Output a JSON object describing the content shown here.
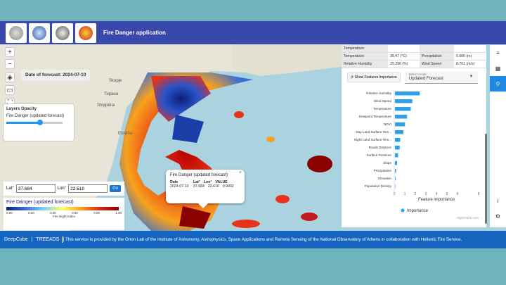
{
  "header": {
    "title": "Fire Danger application",
    "logos": [
      "gov-seal-logo",
      "iaasars-logo",
      "orion-lab-logo",
      "fire-service-logo"
    ],
    "logo_colors": [
      "#8a8a8a",
      "#2d5ea8",
      "#555",
      "#c62828"
    ]
  },
  "map": {
    "forecast_label": "Date of forecast: 2024-07-10",
    "zoom_in": "+",
    "zoom_out": "−",
    "layers_opacity": {
      "title": "Layers Opacity",
      "layer_name": "Fire Danger (updated forecast)",
      "opacity": 0.6
    },
    "coords": {
      "lat_label": "Lat°",
      "lat_value": "37.684",
      "lon_label": "Lon°",
      "lon_value": "22.610",
      "go_label": "Go"
    },
    "legend": {
      "title": "Fire Danger (updated forecast)",
      "ticks": [
        "0.00",
        "0.20",
        "0.40",
        "0.60",
        "0.80",
        "1.00"
      ],
      "subtitle": "Fire Night Index"
    },
    "popup": {
      "title": "Fire Danger (updated forecast)",
      "headers": [
        "Date",
        "Lat°",
        "Lon°",
        "VALUE"
      ],
      "values": [
        "2024-07-10",
        "37.684",
        "22.610",
        "0.9932"
      ],
      "close": "×"
    },
    "place_labels": [
      {
        "text": "Skopje",
        "dx": 155,
        "dy": 53
      },
      {
        "text": "Shqipëria",
        "dx": 138,
        "dy": 88
      },
      {
        "text": "Тирана",
        "dx": 148,
        "dy": 72
      },
      {
        "text": "Ελλάδα",
        "dx": 168,
        "dy": 128
      }
    ]
  },
  "details": {
    "table": [
      [
        "Temperature",
        "",
        "",
        ""
      ],
      [
        "Temperature",
        "35.47 (°C)",
        "Precipitation",
        "0.000 (m)"
      ],
      [
        "Relative Humidity",
        "25.296 (%)",
        "Wind Speed",
        "8.701 (m/s)"
      ]
    ],
    "show_importance_label": "Show Features Importance",
    "select_label": "Select mode",
    "select_value": "Updated Forecast"
  },
  "chart_data": {
    "type": "bar",
    "orientation": "horizontal",
    "categories": [
      "Relative Humidity",
      "Wind Speed",
      "Temperature",
      "Dewpoint Temperature",
      "NDVI",
      "Day Land Surface Tem...",
      "Night Land Surface Tem...",
      "Roads Distance",
      "Surface Pressure",
      "Slope",
      "Precipitation",
      "Elevation",
      "Population Density"
    ],
    "series": [
      {
        "name": "Importance",
        "values": [
          2.35,
          1.65,
          1.5,
          1.15,
          0.95,
          0.8,
          0.5,
          0.45,
          0.3,
          0.2,
          0.1,
          0.05,
          0.0
        ]
      }
    ],
    "xlabel": "Feature importance",
    "xlim": [
      0,
      8
    ],
    "xticks": [
      "0",
      "1",
      "2",
      "3",
      "4",
      "5",
      "6",
      "8"
    ],
    "legend": "bottom-left",
    "credit": "Highcharts.com",
    "bar_color": "#2aa3e6"
  },
  "sidebar": {
    "icons": [
      "menu-icon",
      "calendar-icon",
      "location-icon"
    ],
    "glyphs": [
      "≡",
      "▦",
      "⚲"
    ],
    "bottom_icons": [
      "info-icon",
      "settings-icon"
    ],
    "bottom_glyphs": [
      "i",
      "⚙"
    ]
  },
  "footer": {
    "nav": [
      "DeepCube",
      "|",
      "TREEADS",
      "|"
    ],
    "message": "This service is provided by the Orion Lab of the Institute of Astronomy, Astrophysics, Space Applications and Remote Sensing of the National Observatory of Athens in collaboration with Hellenic Fire Service."
  }
}
